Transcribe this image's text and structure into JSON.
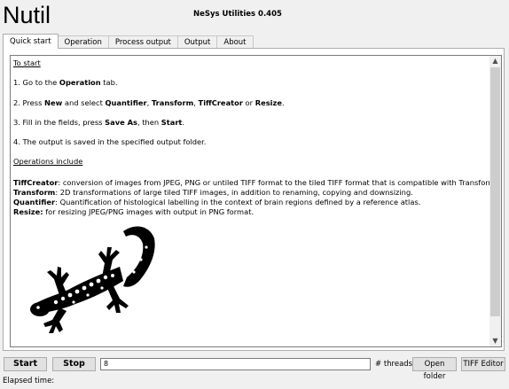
{
  "app": {
    "title": "Nutil",
    "version": "NeSys Utilities 0.405"
  },
  "tabs": [
    {
      "label": "Quick start",
      "active": true
    },
    {
      "label": "Operation",
      "active": false
    },
    {
      "label": "Process output",
      "active": false
    },
    {
      "label": "Output",
      "active": false
    },
    {
      "label": "About",
      "active": false
    }
  ],
  "quickstart": {
    "heading": "To start",
    "step1": {
      "pre": "1. Go to the ",
      "b1": "Operation",
      "post": " tab."
    },
    "step2": {
      "pre": "2. Press ",
      "b1": "New",
      "mid1": " and select ",
      "b2": "Quantifier",
      "sep1": ", ",
      "b3": "Transform",
      "sep2": ", ",
      "b4": "TiffCreator",
      "mid2": " or ",
      "b5": "Resize",
      "post": "."
    },
    "step3": {
      "pre": "3. Fill in the fields, press ",
      "b1": "Save As",
      "mid": ", then ",
      "b2": "Start",
      "post": "."
    },
    "step4": "4. The output is saved in the specified output folder.",
    "ops_heading": "Operations include",
    "ops": [
      {
        "name": "TiffCreator",
        "desc": ": conversion of images from JPEG, PNG or untiled TIFF format to the tiled TIFF format that is compatible with Transform."
      },
      {
        "name": "Transform",
        "desc": ": 2D transformations of large tiled TIFF images, in addition to renaming, copying and downsizing."
      },
      {
        "name": "Quantifier",
        "desc": ": Quantification of histological labelling in the context of brain regions defined by a reference atlas."
      },
      {
        "name": "Resize:",
        "desc": " for resizing JPEG/PNG images with output in PNG format."
      }
    ]
  },
  "icons": {
    "scroll_up": "chevron-up-icon",
    "scroll_down": "chevron-down-icon",
    "logo": "gecko-logo"
  },
  "bottom": {
    "start_label": "Start",
    "stop_label": "Stop",
    "threads_value": "8",
    "threads_label": "# threads",
    "open_folder_label": "Open folder",
    "tiff_editor_label": "TIFF Editor",
    "elapsed_label": "Elapsed time:"
  },
  "colors": {
    "window_bg": "#f0f0f0",
    "panel_bg": "#ffffff",
    "button_bg": "#e1e1e1",
    "scroll_thumb": "#cdcdcd"
  }
}
